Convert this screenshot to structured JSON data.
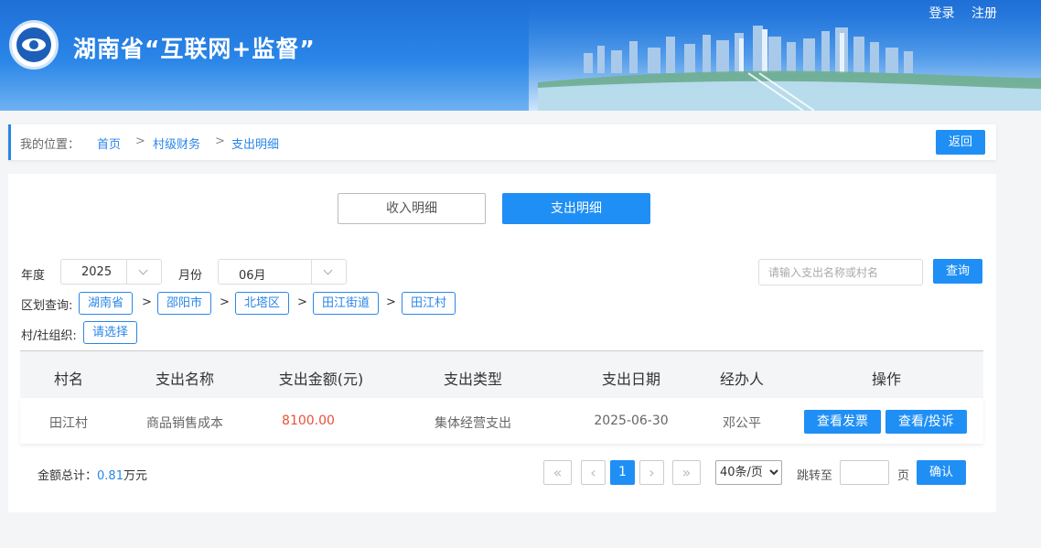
{
  "header": {
    "site_title": "湖南省“互联网+监督”",
    "login": "登录",
    "register": "注册"
  },
  "breadcrumb": {
    "label": "我的位置：",
    "items": [
      "首页",
      "村级财务",
      "支出明细"
    ],
    "separator": ">",
    "back": "返回"
  },
  "tabs": {
    "income": "收入明细",
    "expense": "支出明细",
    "active": "expense"
  },
  "filters": {
    "year_label": "年度",
    "year_value": "2025",
    "month_label": "月份",
    "month_value": "06月",
    "search_placeholder": "请输入支出名称或村名",
    "query_button": "查询",
    "region_label": "区划查询:",
    "region_path": [
      "湖南省",
      "邵阳市",
      "北塔区",
      "田江街道",
      "田江村"
    ],
    "region_separator": ">",
    "org_label": "村/社组织:",
    "org_button": "请选择"
  },
  "table": {
    "columns": [
      "村名",
      "支出名称",
      "支出金额(元)",
      "支出类型",
      "支出日期",
      "经办人",
      "操作"
    ],
    "rows": [
      {
        "village": "田江村",
        "name": "商品销售成本",
        "amount": "8100.00",
        "type": "集体经营支出",
        "date": "2025-06-30",
        "handler": "邓公平",
        "actions": [
          "查看发票",
          "查看/投诉"
        ]
      }
    ]
  },
  "footer": {
    "total_label": "金额总计：",
    "total_value": "0.81",
    "total_unit": "万元",
    "first": "«",
    "prev": "‹",
    "current_page": "1",
    "next": "›",
    "last": "»",
    "page_size_options": [
      "40条/页"
    ],
    "page_size": "40条/页",
    "jump_label": "跳转至",
    "page_unit": "页",
    "confirm": "确认"
  },
  "colors": {
    "primary": "#1f8ff5",
    "link": "#2a86e8",
    "amount": "#e8513a",
    "header_top": "#1f6fd6"
  }
}
